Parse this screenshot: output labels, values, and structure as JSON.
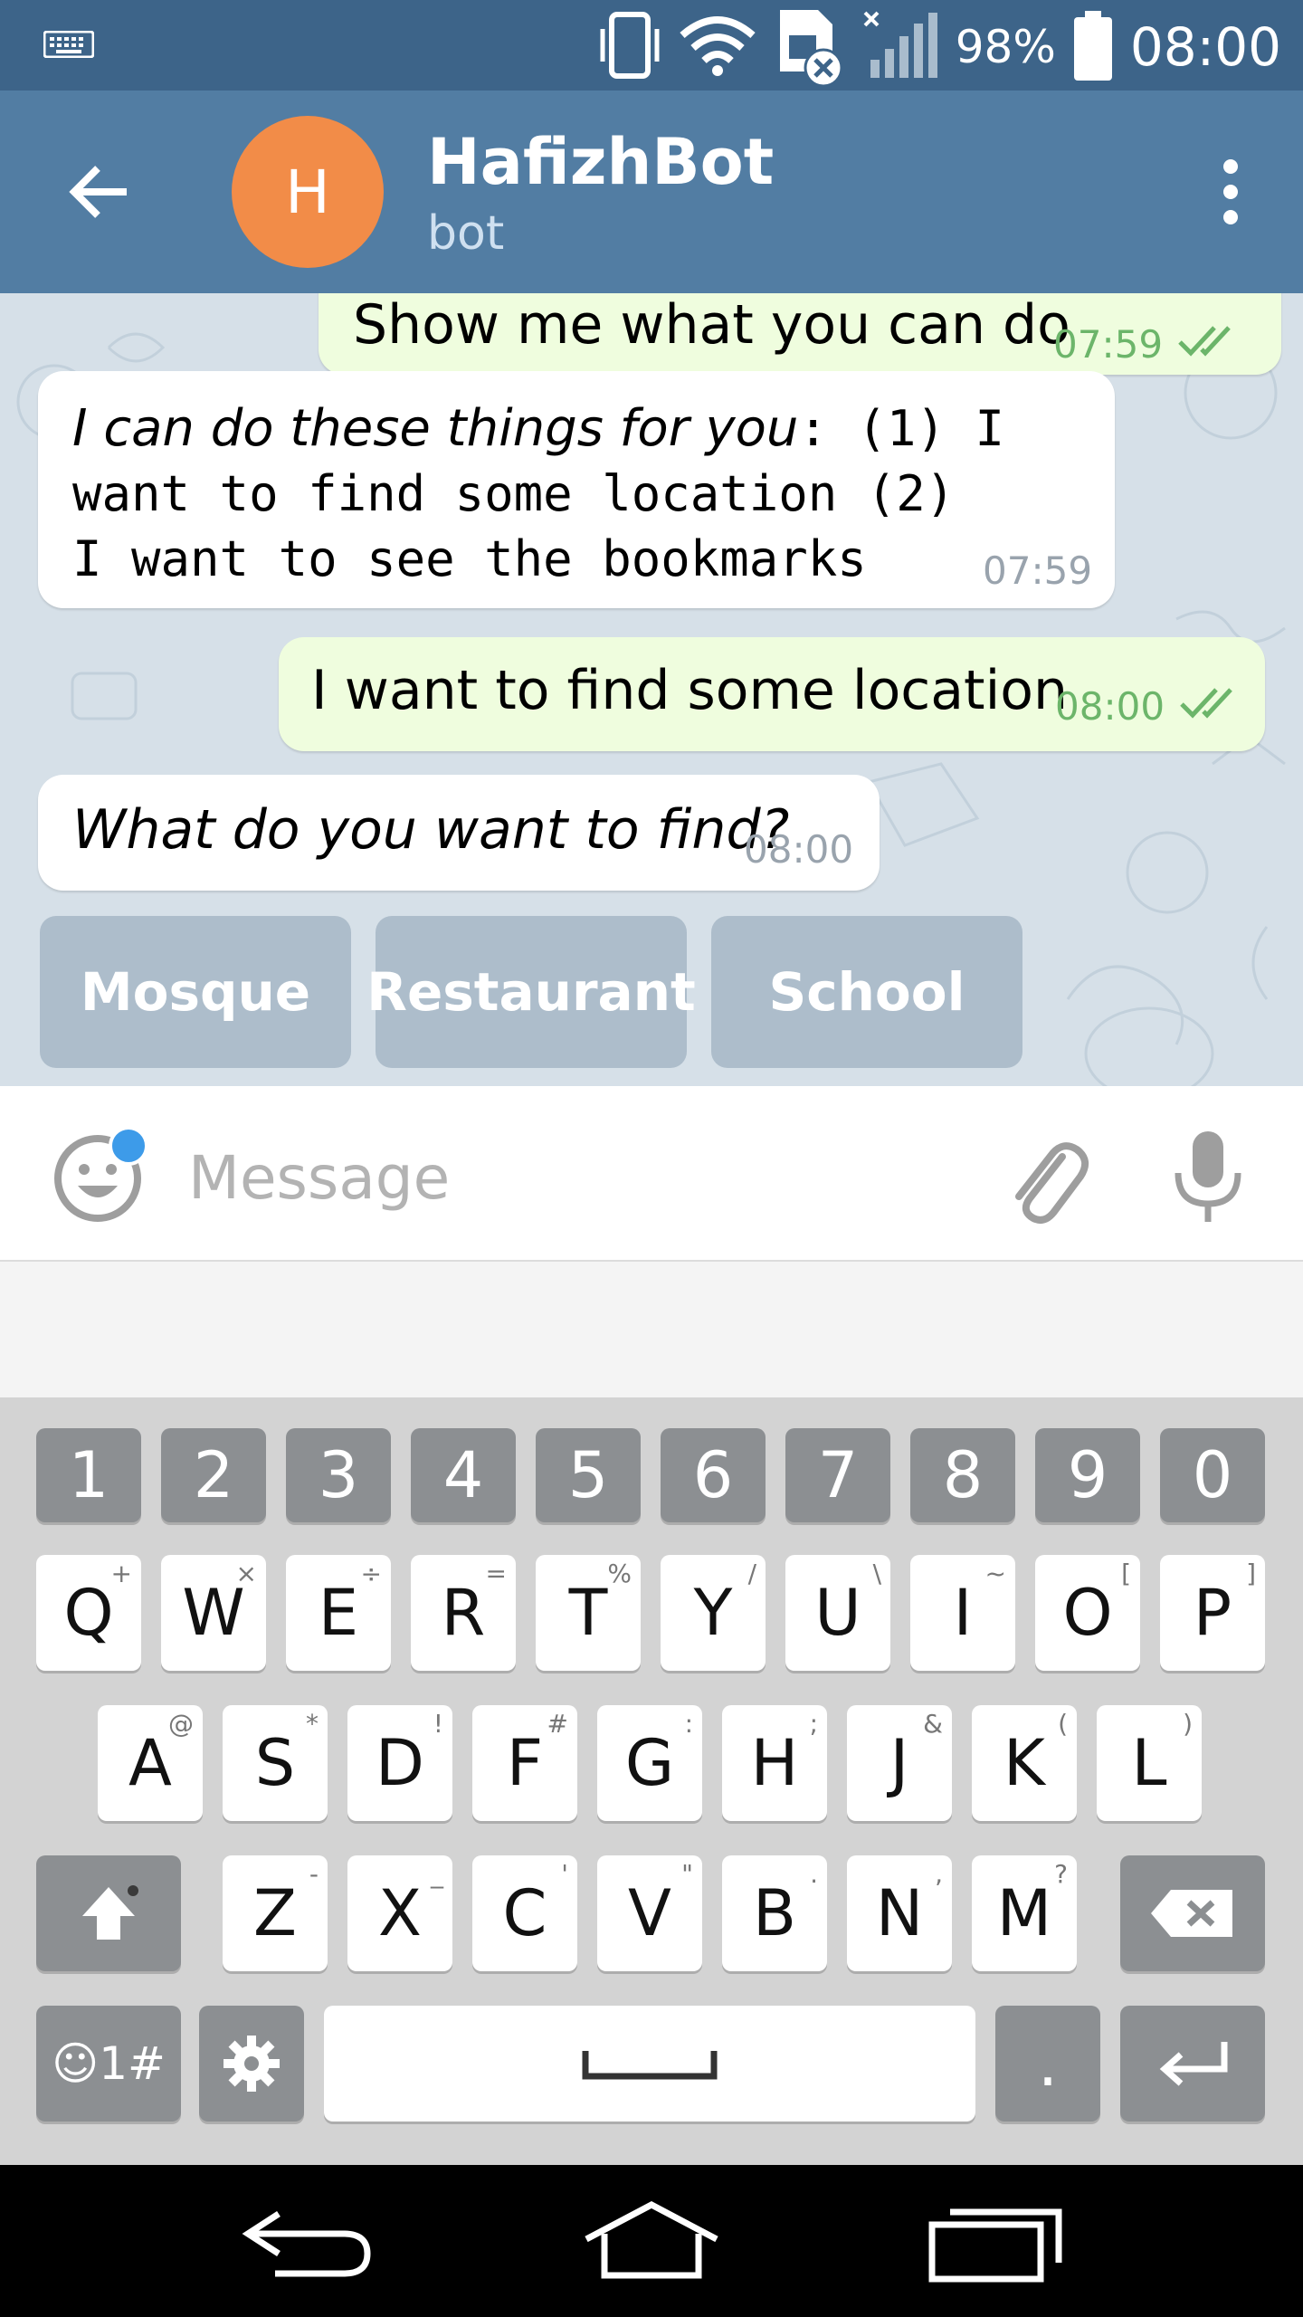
{
  "status_bar": {
    "battery": "98%",
    "time": "08:00"
  },
  "app_bar": {
    "avatar_letter": "H",
    "title": "HafizhBot",
    "subtitle": "bot"
  },
  "messages": [
    {
      "direction": "out",
      "text": "Show me what you can do",
      "time": "07:59"
    },
    {
      "direction": "in",
      "italic_part": "I can do these things for you",
      "rest": ": (1) I want to find some location (2) I want to see the bookmarks",
      "time": "07:59"
    },
    {
      "direction": "out",
      "text": "I want to find some location",
      "time": "08:00"
    },
    {
      "direction": "in",
      "text": "What do you want to find?",
      "time": "08:00"
    }
  ],
  "bot_keyboard": {
    "buttons": [
      "Mosque",
      "Restaurant",
      "School"
    ]
  },
  "input": {
    "placeholder": "Message"
  },
  "keyboard": {
    "number_row": [
      "1",
      "2",
      "3",
      "4",
      "5",
      "6",
      "7",
      "8",
      "9",
      "0"
    ],
    "row1": [
      [
        "Q",
        "+"
      ],
      [
        "W",
        "×"
      ],
      [
        "E",
        "÷"
      ],
      [
        "R",
        "="
      ],
      [
        "T",
        "%"
      ],
      [
        "Y",
        "/"
      ],
      [
        "U",
        "\\"
      ],
      [
        "I",
        "~"
      ],
      [
        "O",
        "["
      ],
      [
        "P",
        "]"
      ]
    ],
    "row2": [
      [
        "A",
        "@"
      ],
      [
        "S",
        "*"
      ],
      [
        "D",
        "!"
      ],
      [
        "F",
        "#"
      ],
      [
        "G",
        ":"
      ],
      [
        "H",
        ";"
      ],
      [
        "J",
        "&"
      ],
      [
        "K",
        "("
      ],
      [
        "L",
        ")"
      ]
    ],
    "row3": [
      [
        "Z",
        "-"
      ],
      [
        "X",
        "_"
      ],
      [
        "C",
        "'"
      ],
      [
        "V",
        "\""
      ],
      [
        "B",
        "."
      ],
      [
        "N",
        ","
      ],
      [
        "M",
        "?"
      ]
    ],
    "symbols_label": "☺1#",
    "period": "."
  },
  "colors": {
    "status_bar": "#3d6489",
    "app_bar": "#527da3",
    "avatar": "#f28c48",
    "out_bubble": "#effdde",
    "time_out": "#6cb56a"
  }
}
